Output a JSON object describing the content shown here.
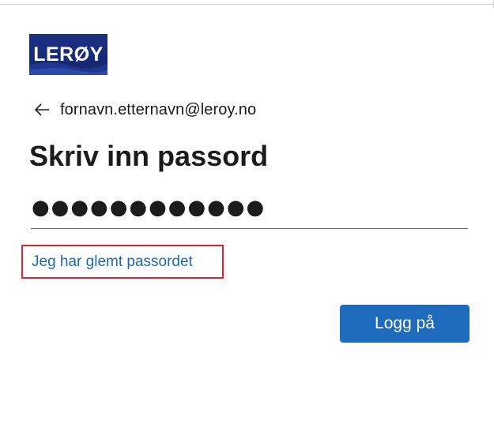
{
  "brand": {
    "logo_text": "LERØY",
    "logo_color": "#1b2f83"
  },
  "identity": {
    "back_icon": "arrow-left-icon",
    "email": "fornavn.etternavn@leroy.no"
  },
  "page": {
    "title": "Skriv inn passord"
  },
  "password": {
    "masked_value": "●●●●●●●●●●●●"
  },
  "links": {
    "forgot_password": "Jeg har glemt passordet",
    "highlight_color": "#e0242e",
    "link_color": "#1e68b3"
  },
  "actions": {
    "signin_label": "Logg på",
    "button_color": "#1e6bbd"
  }
}
